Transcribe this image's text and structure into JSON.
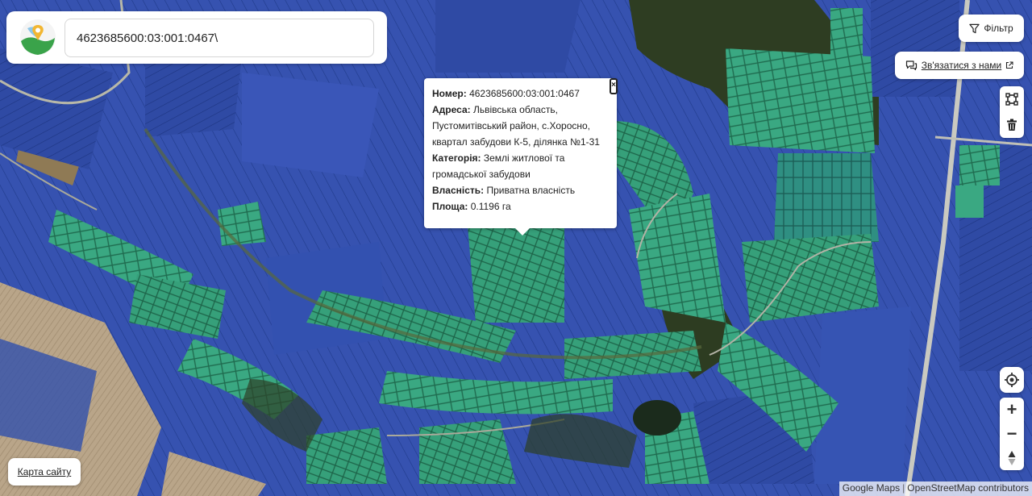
{
  "search": {
    "value": "4623685600:03:001:0467\\"
  },
  "popup": {
    "number_label": "Номер:",
    "number_value": "4623685600:03:001:0467",
    "address_label": "Адреса:",
    "address_value": "Львівська область, Пустомитівський район, с.Хоросно, квартал забудови К-5, ділянка №1-31",
    "category_label": "Категорія:",
    "category_value": "Землі житлової та громадської забудови",
    "ownership_label": "Власність:",
    "ownership_value": "Приватна власність",
    "area_label": "Площа:",
    "area_value": "0.1196 га"
  },
  "controls": {
    "filter_label": "Фільтр",
    "contact_label": "Зв'язатися з нами",
    "sitemap_label": "Карта сайту",
    "zoom_in": "+",
    "zoom_out": "−"
  },
  "attribution": {
    "google": "Google Maps",
    "osm": "OpenStreetMap contributors"
  },
  "colors": {
    "parcel_blue": "#3a55b5",
    "parcel_green": "#3fae8a",
    "fields_dark": "#3e4c2a",
    "road": "#c9c9c0"
  }
}
